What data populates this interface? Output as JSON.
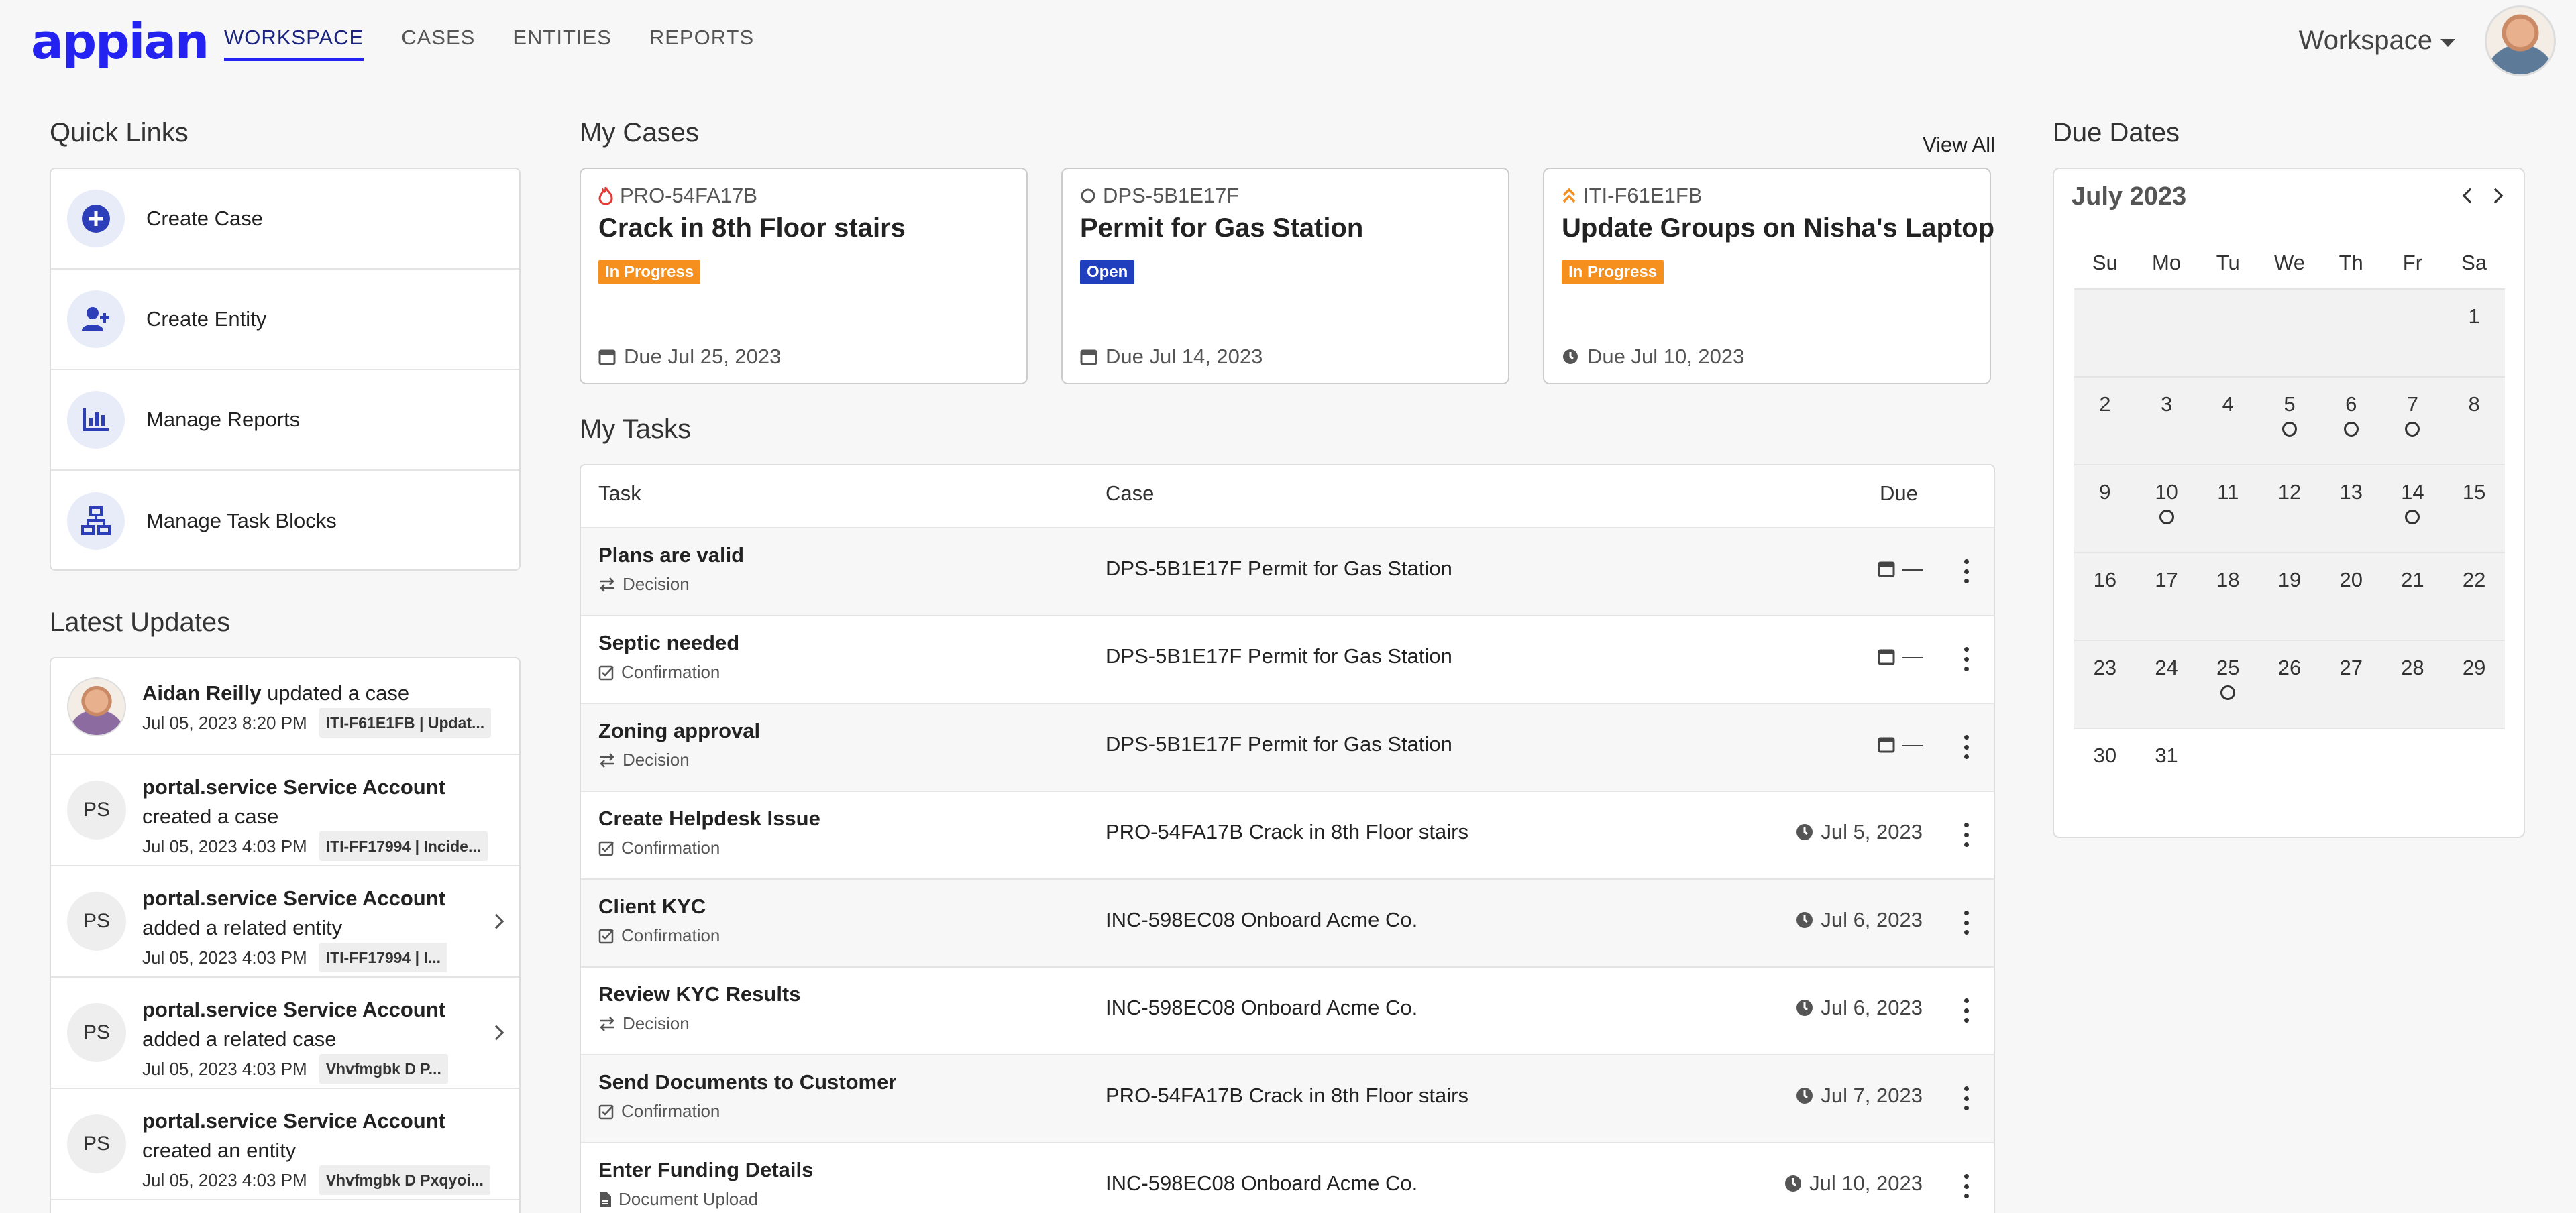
{
  "header": {
    "logo": "appian",
    "nav": [
      "WORKSPACE",
      "CASES",
      "ENTITIES",
      "REPORTS"
    ],
    "workspace_menu": "Workspace"
  },
  "quick_links": {
    "title": "Quick Links",
    "items": [
      {
        "label": "Create Case",
        "icon": "plus-circle-icon"
      },
      {
        "label": "Create Entity",
        "icon": "add-user-icon"
      },
      {
        "label": "Manage Reports",
        "icon": "bar-chart-icon"
      },
      {
        "label": "Manage Task Blocks",
        "icon": "sitemap-icon"
      }
    ]
  },
  "latest_updates": {
    "title": "Latest Updates",
    "items": [
      {
        "avatar": "",
        "actor": "Aidan Reilly",
        "action": "updated a case",
        "time": "Jul 05, 2023 8:20 PM",
        "tag": "ITI-F61E1FB | Updat..."
      },
      {
        "avatar": "PS",
        "actor": "portal.service Service Account",
        "action": "created a case",
        "time": "Jul 05, 2023 4:03 PM",
        "tag": "ITI-FF17994 | Incide..."
      },
      {
        "avatar": "PS",
        "actor": "portal.service Service Account",
        "action": "added a related entity",
        "time": "Jul 05, 2023 4:03 PM",
        "tag": "ITI-FF17994 | I..."
      },
      {
        "avatar": "PS",
        "actor": "portal.service Service Account",
        "action": "added a related case",
        "time": "Jul 05, 2023 4:03 PM",
        "tag": "Vhvfmgbk D P..."
      },
      {
        "avatar": "PS",
        "actor": "portal.service Service Account",
        "action": "created an entity",
        "time": "Jul 05, 2023 4:03 PM",
        "tag": "Vhvfmgbk D Pxqyoi..."
      }
    ]
  },
  "my_cases": {
    "title": "My Cases",
    "view_all": "View All",
    "cases": [
      {
        "id": "PRO-54FA17B",
        "title": "Crack in 8th Floor stairs",
        "status": "In Progress",
        "status_color": "#f5901e",
        "due": "Due Jul 25, 2023",
        "priority_icon": "fire-icon"
      },
      {
        "id": "DPS-5B1E17F",
        "title": "Permit for Gas Station",
        "status": "Open",
        "status_color": "#1f3fbf",
        "due": "Due Jul 14, 2023",
        "priority_icon": "circle-icon"
      },
      {
        "id": "ITI-F61E1FB",
        "title": "Update Groups on Nisha's Laptop",
        "status": "In Progress",
        "status_color": "#f5901e",
        "due": "Due Jul 10, 2023",
        "priority_icon": "double-chevron-up-icon"
      }
    ]
  },
  "my_tasks": {
    "title": "My Tasks",
    "columns": [
      "Task",
      "Case",
      "Due"
    ],
    "rows": [
      {
        "task": "Plans are valid",
        "type": "Decision",
        "case": "DPS-5B1E17F Permit for Gas Station",
        "due": "—"
      },
      {
        "task": "Septic needed",
        "type": "Confirmation",
        "case": "DPS-5B1E17F Permit for Gas Station",
        "due": "—"
      },
      {
        "task": "Zoning approval",
        "type": "Decision",
        "case": "DPS-5B1E17F Permit for Gas Station",
        "due": "—"
      },
      {
        "task": "Create Helpdesk Issue",
        "type": "Confirmation",
        "case": "PRO-54FA17B Crack in 8th Floor stairs",
        "due": "Jul 5, 2023"
      },
      {
        "task": "Client KYC",
        "type": "Confirmation",
        "case": "INC-598EC08 Onboard Acme Co.",
        "due": "Jul 6, 2023"
      },
      {
        "task": "Review KYC Results",
        "type": "Decision",
        "case": "INC-598EC08 Onboard Acme Co.",
        "due": "Jul 6, 2023"
      },
      {
        "task": "Send Documents to Customer",
        "type": "Confirmation",
        "case": "PRO-54FA17B Crack in 8th Floor stairs",
        "due": "Jul 7, 2023"
      },
      {
        "task": "Enter Funding Details",
        "type": "Document Upload",
        "case": "INC-598EC08 Onboard Acme Co.",
        "due": "Jul 10, 2023"
      }
    ]
  },
  "due_dates": {
    "title": "Due Dates",
    "month": "July 2023",
    "weekdays": [
      "Su",
      "Mo",
      "Tu",
      "We",
      "Th",
      "Fr",
      "Sa"
    ],
    "weeks": [
      [
        "",
        "",
        "",
        "",
        "",
        "",
        "1"
      ],
      [
        "2",
        "3",
        "4",
        "5",
        "6",
        "7",
        "8"
      ],
      [
        "9",
        "10",
        "11",
        "12",
        "13",
        "14",
        "15"
      ],
      [
        "16",
        "17",
        "18",
        "19",
        "20",
        "21",
        "22"
      ],
      [
        "23",
        "24",
        "25",
        "26",
        "27",
        "28",
        "29"
      ],
      [
        "30",
        "31",
        "",
        "",
        "",
        "",
        ""
      ]
    ],
    "days_with_tasks": [
      "5",
      "6",
      "7",
      "10",
      "14",
      "25"
    ]
  }
}
